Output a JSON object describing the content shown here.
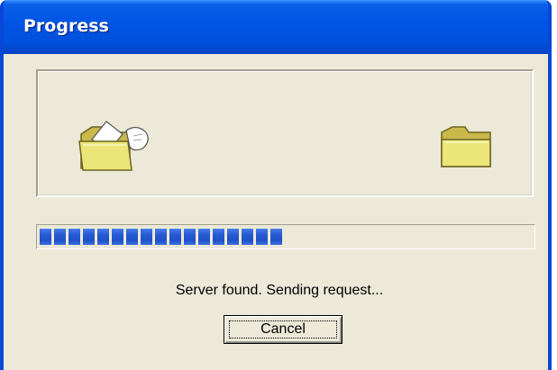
{
  "window": {
    "title": "Progress"
  },
  "animation": {
    "source_icon": "folder-with-flying-document-icon",
    "destination_icon": "folder-icon"
  },
  "progress": {
    "filled_segments": 17,
    "fraction": 0.58
  },
  "status": {
    "text": "Server found. Sending request..."
  },
  "buttons": {
    "cancel_label": "Cancel"
  },
  "colors": {
    "titlebar": "#0055e5",
    "face": "#ece9d8",
    "progress": "#2a5fd6"
  }
}
